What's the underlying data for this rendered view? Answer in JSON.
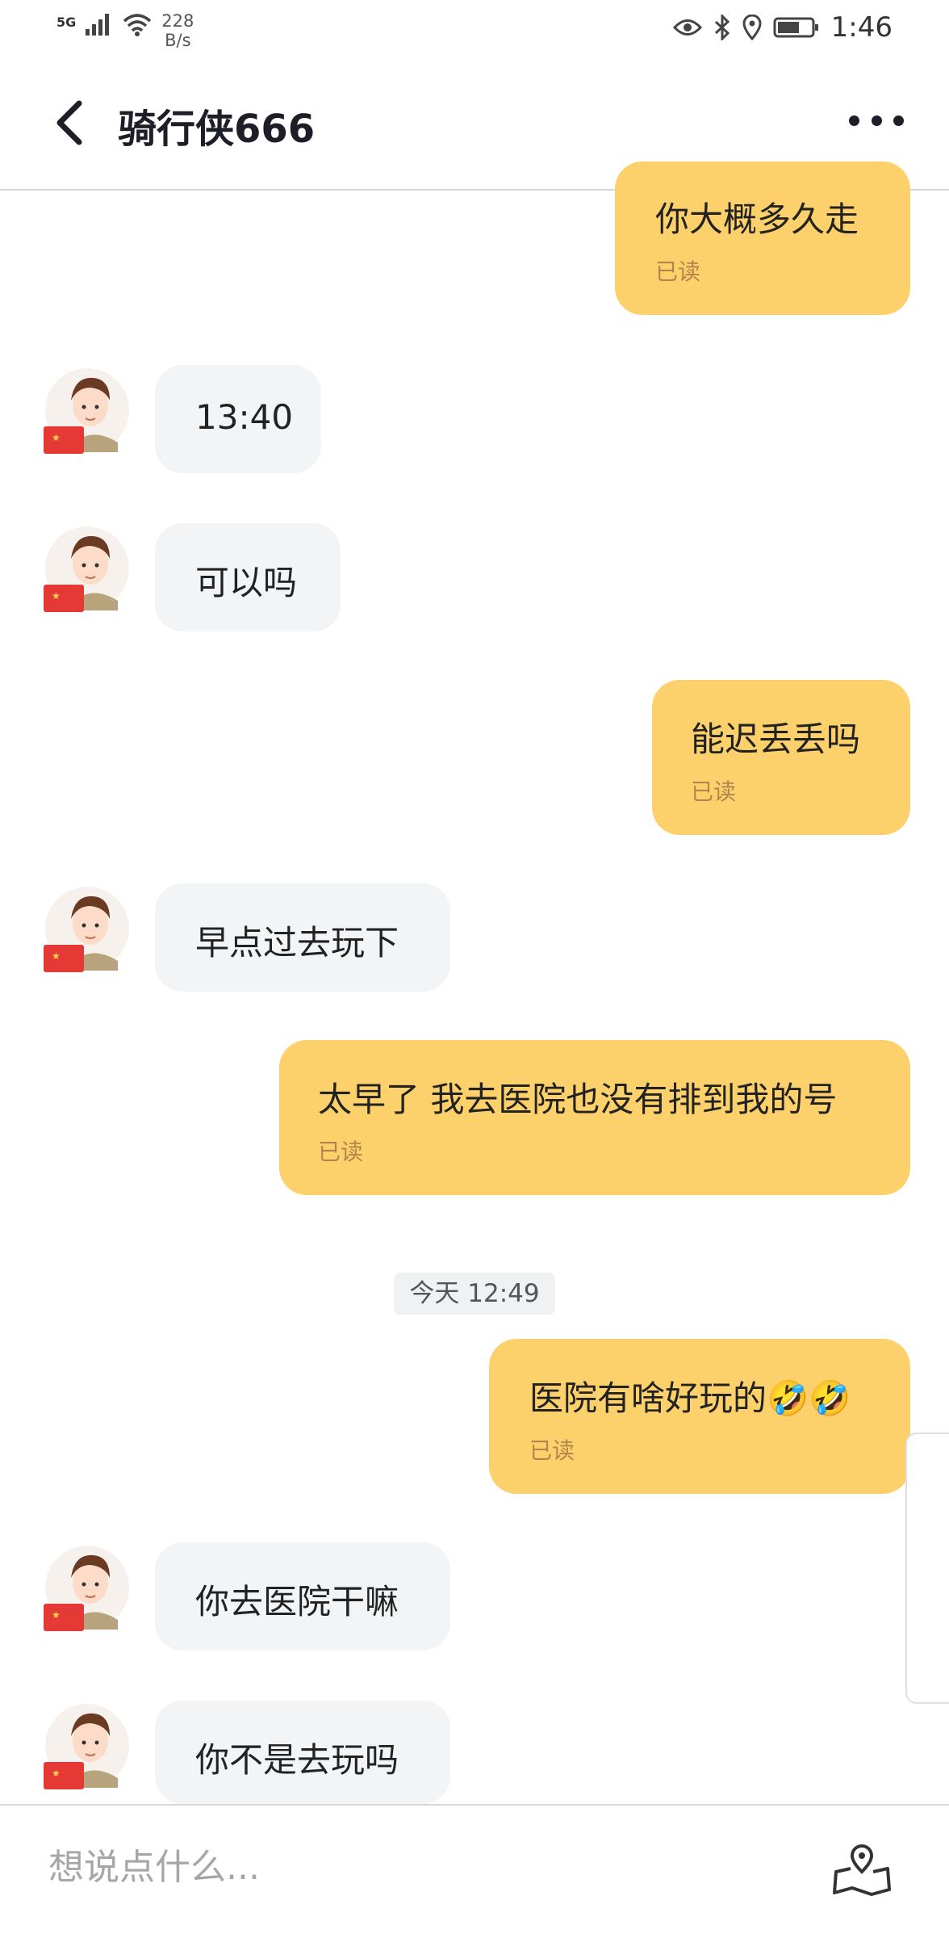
{
  "status_bar": {
    "network": "5G",
    "speed_value": "228",
    "speed_unit": "B/s",
    "time": "1:46"
  },
  "header": {
    "title": "骑行侠666"
  },
  "messages": [
    {
      "side": "out",
      "text": "你大概多久走",
      "read": "已读"
    },
    {
      "side": "in",
      "text": "13:40"
    },
    {
      "side": "in",
      "text": "可以吗"
    },
    {
      "side": "out",
      "text": "能迟丢丢吗",
      "read": "已读"
    },
    {
      "side": "in",
      "text": "早点过去玩下"
    },
    {
      "side": "out",
      "text": "太早了 我去医院也没有排到我的号",
      "read": "已读"
    },
    {
      "side": "out",
      "text": "医院有啥好玩的🤣🤣",
      "read": "已读"
    },
    {
      "side": "in",
      "text": "你去医院干嘛"
    },
    {
      "side": "in",
      "text": "你不是去玩吗"
    }
  ],
  "timestamp": "今天 12:49",
  "input": {
    "placeholder": "想说点什么..."
  },
  "icons": {
    "back": "chevron-left-icon",
    "more": "more-dots-icon",
    "location": "location-map-icon",
    "avatar": "cartoon-avatar-with-china-flag"
  },
  "colors": {
    "outgoing_bubble": "#fcd16b",
    "incoming_bubble": "#f3f4f6",
    "read_receipt": "#b2854c"
  }
}
